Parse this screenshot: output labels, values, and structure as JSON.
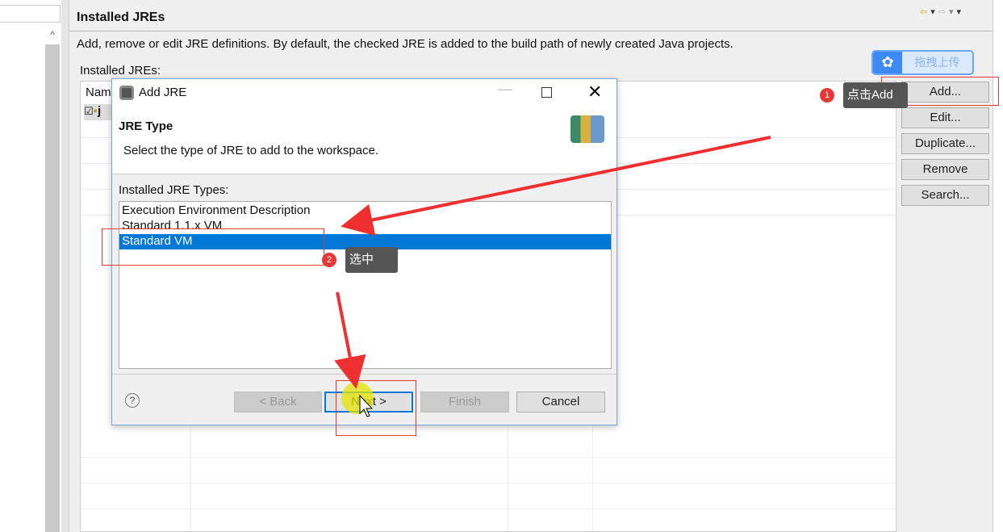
{
  "left_panel": {
    "filter_value": ""
  },
  "page": {
    "title": "Installed JREs",
    "description": "Add, remove or edit JRE definitions. By default, the checked JRE is added to the build path of newly created Java projects.",
    "table_label": "Installed JREs:",
    "column_name": "Nam",
    "first_row": "j",
    "buttons": [
      "Add...",
      "Edit...",
      "Duplicate...",
      "Remove",
      "Search..."
    ],
    "upload_widget_label": "拖拽上传"
  },
  "dialog": {
    "title": "Add JRE",
    "heading": "JRE Type",
    "subheading": "Select the type of JRE to add to the workspace.",
    "list_label": "Installed JRE Types:",
    "types": [
      "Execution Environment Description",
      "Standard 1.1.x VM",
      "Standard VM"
    ],
    "selected_type": "Standard VM",
    "buttons": {
      "back": "< Back",
      "next": "Next >",
      "finish": "Finish",
      "cancel": "Cancel"
    }
  },
  "annotations": [
    {
      "number": "1",
      "text": "点击Add"
    },
    {
      "number": "2",
      "text": "选中"
    }
  ],
  "colors": {
    "selection": "#0078d7",
    "annotation_red": "#e53935",
    "tooltip_bg": "#555555",
    "upload_blue": "#3d8af7"
  }
}
